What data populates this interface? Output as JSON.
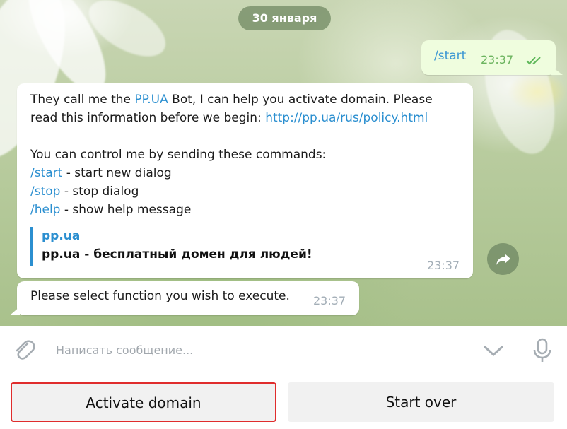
{
  "chat": {
    "date": "30 января",
    "outgoing": {
      "text": "/start",
      "time": "23:37"
    },
    "incoming": {
      "intro_prefix": "They call me the ",
      "intro_link": "PP.UA",
      "intro_suffix": " Bot, I can help you activate domain. Please",
      "read_prefix": "read this information before we begin: ",
      "policy_link": "http://pp.ua/rus/policy.html",
      "commands_intro": "You can control me by sending these commands:",
      "commands": [
        {
          "cmd": "/start",
          "desc": " - start new dialog"
        },
        {
          "cmd": "/stop",
          "desc": " - stop dialog"
        },
        {
          "cmd": "/help",
          "desc": " - show help message"
        }
      ],
      "preview_title": "pp.ua",
      "preview_desc": "pp.ua - бесплатный домен для людей!",
      "time": "23:37"
    },
    "incoming2": {
      "text": "Please select function you wish to execute.",
      "time": "23:37"
    }
  },
  "composer": {
    "placeholder": "Написать сообщение..."
  },
  "keyboard": {
    "buttons": [
      "Activate domain",
      "Start over"
    ]
  },
  "colors": {
    "link": "#2b8fd0",
    "outgoing_bg": "#effdde",
    "highlight": "#e02d2d"
  },
  "icons": [
    "attach-icon",
    "chevron-down-icon",
    "microphone-icon",
    "share-icon",
    "double-check-icon"
  ]
}
